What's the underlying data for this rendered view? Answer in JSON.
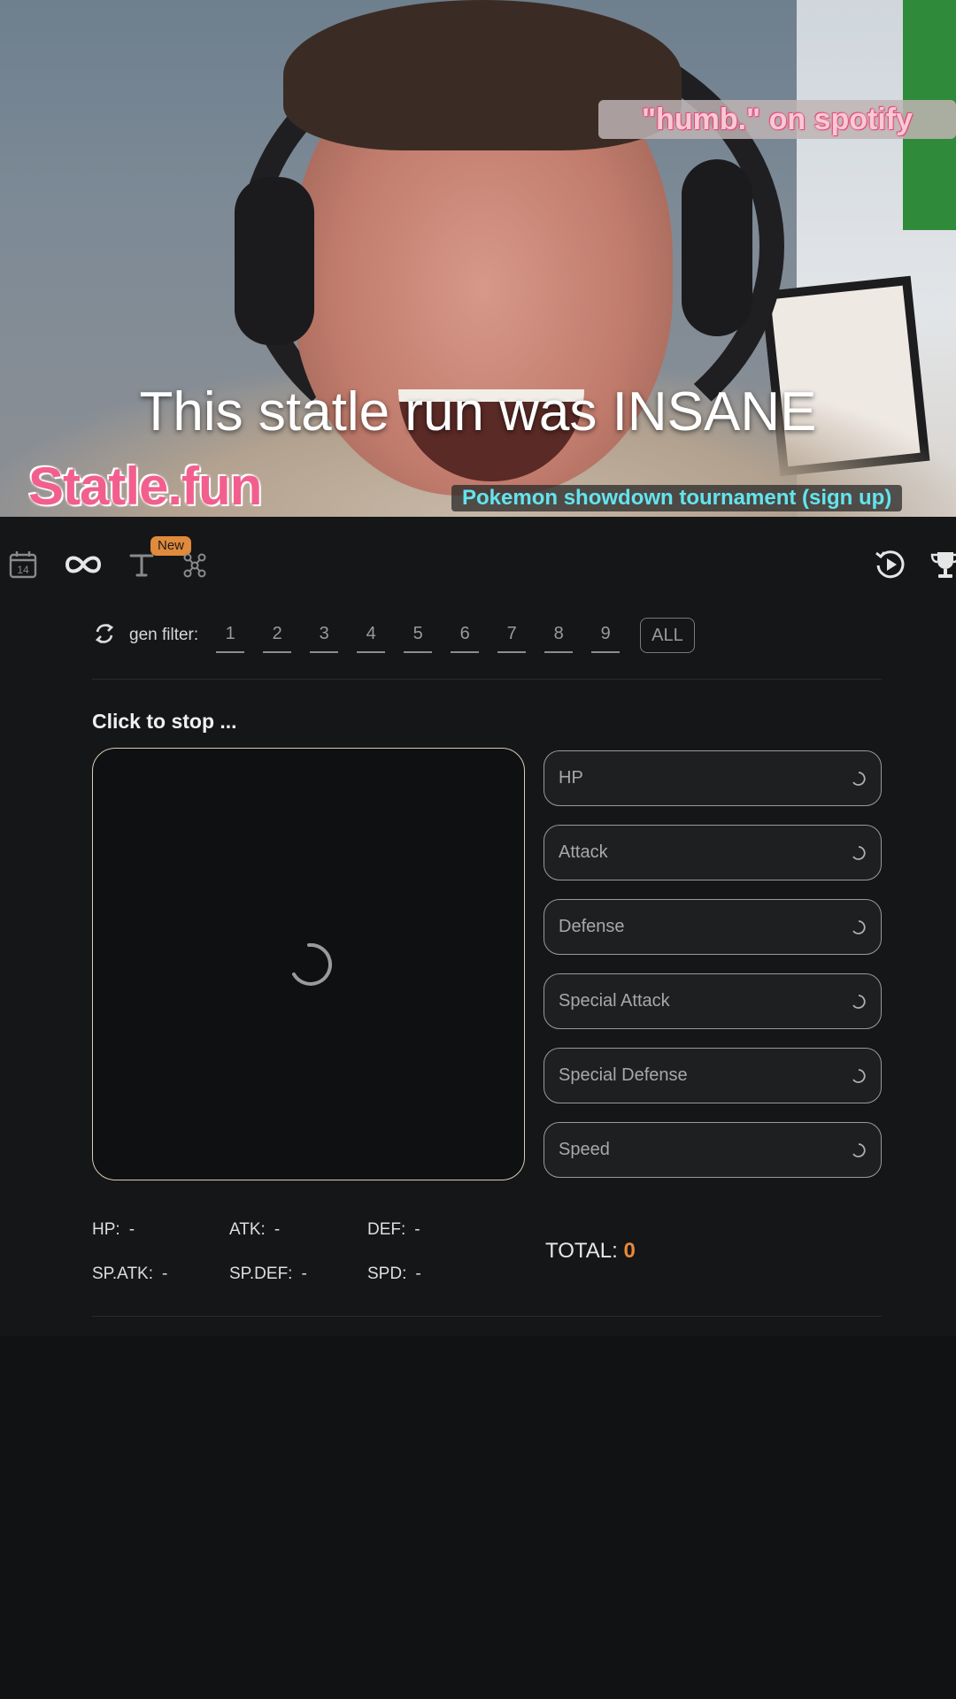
{
  "video": {
    "overlay_tag": "\"humb.\" on spotify",
    "caption": "This statle run was INSANE",
    "brand": "Statle.fun",
    "signup": "Pokemon showdown tournament (sign up)"
  },
  "topbar": {
    "calendar_day": "14",
    "new_badge": "New",
    "icons": [
      "calendar-icon",
      "infinity-icon",
      "type-icon",
      "graph-icon",
      "replay-icon",
      "trophy-icon"
    ]
  },
  "gen_filter": {
    "label": "gen filter:",
    "options": [
      "1",
      "2",
      "3",
      "4",
      "5",
      "6",
      "7",
      "8",
      "9"
    ],
    "all_label": "ALL"
  },
  "main": {
    "prompt": "Click to stop ..."
  },
  "stat_buttons": [
    "HP",
    "Attack",
    "Defense",
    "Special Attack",
    "Special Defense",
    "Speed"
  ],
  "summary": {
    "hp_label": "HP:",
    "hp_value": "-",
    "atk_label": "ATK:",
    "atk_value": "-",
    "def_label": "DEF:",
    "def_value": "-",
    "spatk_label": "SP.ATK:",
    "spatk_value": "-",
    "spdef_label": "SP.DEF:",
    "spdef_value": "-",
    "spd_label": "SPD:",
    "spd_value": "-",
    "total_label": "TOTAL:",
    "total_value": "0"
  },
  "colors": {
    "accent": "#e8893a",
    "background": "#151618",
    "brand_pink": "#f25f8f",
    "signup_cyan": "#63e4ee"
  }
}
